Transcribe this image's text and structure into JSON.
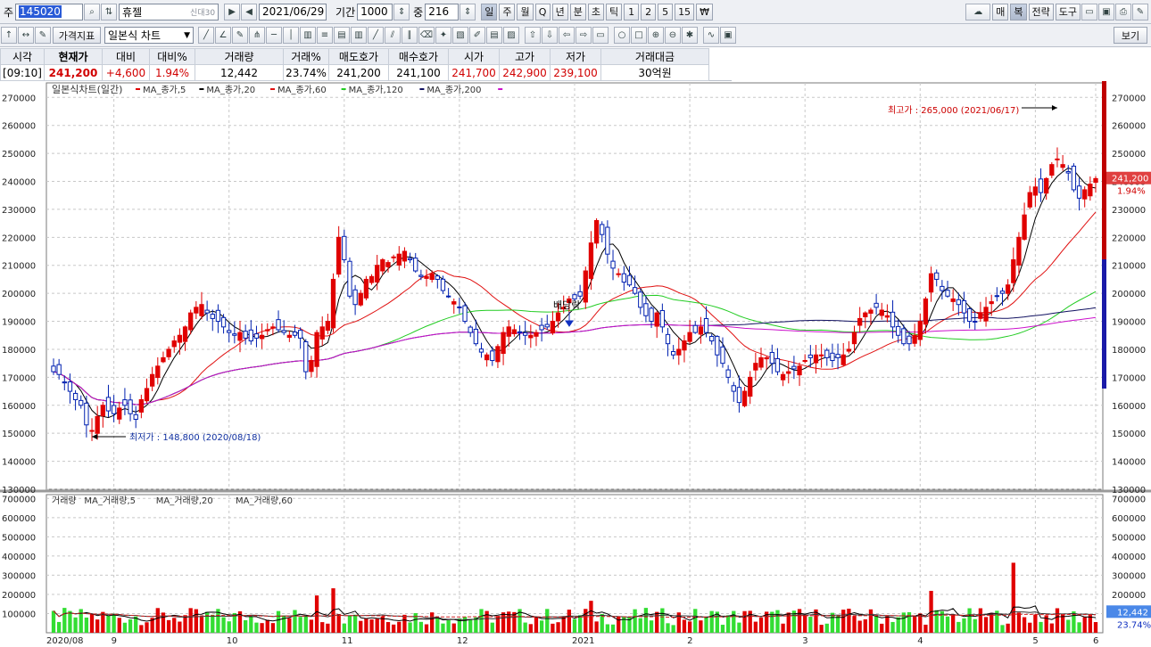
{
  "toolbar1": {
    "prefix": "주",
    "code": "145020",
    "name": "휴젤",
    "name_tags": "신대30",
    "date": "2021/06/29",
    "period_label": "기간",
    "period_value": "1000",
    "mid_label": "중",
    "mid_value": "216",
    "intervals": [
      "일",
      "주",
      "월",
      "Q",
      "년",
      "분",
      "초",
      "틱",
      "1",
      "2",
      "5",
      "15",
      "₩"
    ],
    "active_interval": "일",
    "right_buttons": [
      "매",
      "복",
      "전략",
      "도구"
    ]
  },
  "toolbar2": {
    "price_indicator_label": "가격지표",
    "chart_type_label": "일본식 차트",
    "view_button": "보기"
  },
  "quote": {
    "headers": [
      "시각",
      "현재가",
      "대비",
      "대비%",
      "거래량",
      "거래%",
      "매도호가",
      "매수호가",
      "시가",
      "고가",
      "저가",
      "거래대금"
    ],
    "values": [
      "[09:10]",
      "241,200",
      "+4,600",
      "1.94%",
      "12,442",
      "23.74%",
      "241,200",
      "241,100",
      "241,700",
      "242,900",
      "239,100",
      "30억원"
    ]
  },
  "chart_data": {
    "type": "candlestick",
    "title": "일본식차트(일간)",
    "legend": [
      "MA_종가,5",
      "MA_종가,20",
      "MA_종가,60",
      "MA_종가,120",
      "MA_종가,200"
    ],
    "volume_legend": [
      "거래량",
      "MA_거래량,5",
      "MA_거래량,20",
      "MA_거래량,60"
    ],
    "y_ticks": [
      130000,
      140000,
      150000,
      160000,
      170000,
      180000,
      190000,
      200000,
      210000,
      220000,
      230000,
      240000,
      250000,
      260000,
      270000
    ],
    "ylim": [
      130000,
      272000
    ],
    "volume_ticks": [
      100000,
      200000,
      300000,
      400000,
      500000,
      600000,
      700000
    ],
    "x_labels": [
      "2020/08",
      "9",
      "10",
      "11",
      "12",
      "2021",
      "2",
      "3",
      "4",
      "5",
      "6"
    ],
    "max_annotation": "최고가 : 265,000 (2021/06/17)",
    "min_annotation": "최저가 : 148,800 (2020/08/18)",
    "event_label": "배당락",
    "last_price_label": "241,200",
    "change_pct_label": "1.94%",
    "last_volume_label": "12,442",
    "volume_pct_label": "23.74%",
    "colors": {
      "up": "#e00000",
      "down": "#0020b0",
      "ma5": "#000000",
      "ma20": "#e01010",
      "ma60": "#22cc22",
      "ma120": "#101060",
      "ma200": "#cc11cc",
      "vol_up": "#e00000",
      "vol_down": "#33dd33"
    },
    "closes": [
      172,
      171,
      168,
      165,
      162,
      160,
      153,
      151,
      156,
      160,
      158,
      157,
      159,
      160,
      157,
      155,
      162,
      166,
      171,
      174,
      177,
      180,
      183,
      185,
      188,
      193,
      195,
      196,
      193,
      191,
      190,
      188,
      186,
      185,
      186,
      184,
      183,
      184,
      185,
      187,
      188,
      187,
      186,
      185,
      185,
      184,
      172,
      176,
      186,
      188,
      190,
      205,
      220,
      212,
      199,
      196,
      200,
      205,
      206,
      210,
      212,
      211,
      213,
      214,
      215,
      212,
      208,
      206,
      206,
      207,
      205,
      201,
      199,
      197,
      195,
      190,
      186,
      182,
      179,
      178,
      176,
      181,
      186,
      188,
      187,
      186,
      185,
      185,
      186,
      187,
      188,
      190,
      193,
      195,
      198,
      198,
      199,
      208,
      218,
      226,
      221,
      214,
      209,
      207,
      204,
      203,
      200,
      195,
      192,
      190,
      193,
      188,
      182,
      178,
      180,
      183,
      186,
      186,
      188,
      186,
      183,
      178,
      175,
      170,
      165,
      161,
      165,
      170,
      175,
      177,
      177,
      175,
      172,
      171,
      172,
      173,
      174,
      176,
      177,
      178,
      178,
      177,
      176,
      177,
      178,
      180,
      186,
      191,
      193,
      194,
      195,
      194,
      192,
      188,
      185,
      182,
      182,
      185,
      190,
      198,
      207,
      205,
      201,
      199,
      198,
      196,
      193,
      190,
      190,
      193,
      195,
      197,
      199,
      200,
      203,
      212,
      220,
      228,
      236,
      238,
      236,
      241,
      246,
      248,
      246,
      243,
      237,
      234,
      237,
      239,
      241
    ]
  }
}
